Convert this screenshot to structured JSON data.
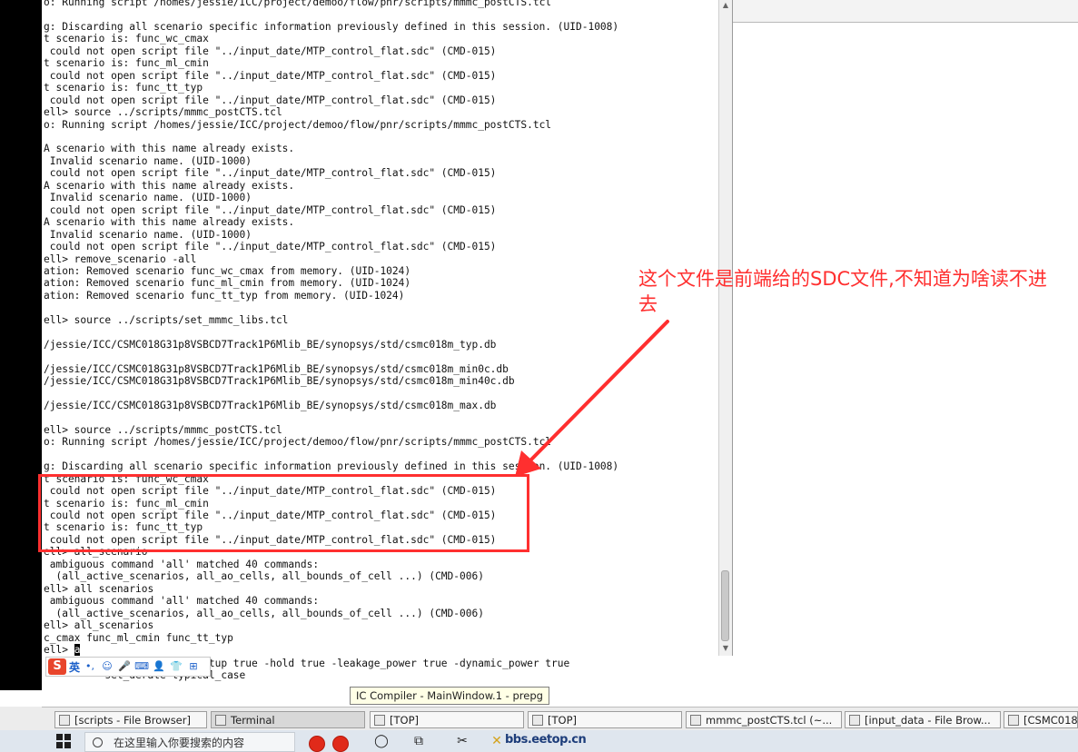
{
  "terminal": {
    "lines": [
      "o: Running script /homes/jessie/ICC/project/demoo/flow/pnr/scripts/mmmc_postCTS.tcl",
      "",
      "g: Discarding all scenario specific information previously defined in this session. (UID-1008)",
      "t scenario is: func_wc_cmax",
      " could not open script file \"../input_date/MTP_control_flat.sdc\" (CMD-015)",
      "t scenario is: func_ml_cmin",
      " could not open script file \"../input_date/MTP_control_flat.sdc\" (CMD-015)",
      "t scenario is: func_tt_typ",
      " could not open script file \"../input_date/MTP_control_flat.sdc\" (CMD-015)",
      "ell> source ../scripts/mmmc_postCTS.tcl",
      "o: Running script /homes/jessie/ICC/project/demoo/flow/pnr/scripts/mmmc_postCTS.tcl",
      "",
      "A scenario with this name already exists.",
      " Invalid scenario name. (UID-1000)",
      " could not open script file \"../input_date/MTP_control_flat.sdc\" (CMD-015)",
      "A scenario with this name already exists.",
      " Invalid scenario name. (UID-1000)",
      " could not open script file \"../input_date/MTP_control_flat.sdc\" (CMD-015)",
      "A scenario with this name already exists.",
      " Invalid scenario name. (UID-1000)",
      " could not open script file \"../input_date/MTP_control_flat.sdc\" (CMD-015)",
      "ell> remove_scenario -all",
      "ation: Removed scenario func_wc_cmax from memory. (UID-1024)",
      "ation: Removed scenario func_ml_cmin from memory. (UID-1024)",
      "ation: Removed scenario func_tt_typ from memory. (UID-1024)",
      "",
      "ell> source ../scripts/set_mmmc_libs.tcl",
      "",
      "/jessie/ICC/CSMC018G31p8VSBCD7Track1P6Mlib_BE/synopsys/std/csmc018m_typ.db",
      "",
      "/jessie/ICC/CSMC018G31p8VSBCD7Track1P6Mlib_BE/synopsys/std/csmc018m_min0c.db",
      "/jessie/ICC/CSMC018G31p8VSBCD7Track1P6Mlib_BE/synopsys/std/csmc018m_min40c.db",
      "",
      "/jessie/ICC/CSMC018G31p8VSBCD7Track1P6Mlib_BE/synopsys/std/csmc018m_max.db",
      "",
      "ell> source ../scripts/mmmc_postCTS.tcl",
      "o: Running script /homes/jessie/ICC/project/demoo/flow/pnr/scripts/mmmc_postCTS.tcl",
      "",
      "g: Discarding all scenario specific information previously defined in this session. (UID-1008)",
      "t scenario is: func_wc_cmax",
      " could not open script file \"../input_date/MTP_control_flat.sdc\" (CMD-015)",
      "t scenario is: func_ml_cmin",
      " could not open script file \"../input_date/MTP_control_flat.sdc\" (CMD-015)",
      "t scenario is: func_tt_typ",
      " could not open script file \"../input_date/MTP_control_flat.sdc\" (CMD-015)",
      "ell> all_scenario",
      " ambiguous command 'all' matched 40 commands:",
      "  (all_active_scenarios, all_ao_cells, all_bounds_of_cell ...) (CMD-006)",
      "ell> all scenarios",
      " ambiguous command 'all' matched 40 commands:",
      "  (all_active_scenarios, all_ao_cells, all_bounds_of_cell ...) (CMD-006)",
      "ell> all_scenarios",
      "c_cmax func_ml_cmin func_tt_typ"
    ],
    "prompt": "ell> ",
    "input": "a"
  },
  "below_lines": [
    "                    ons -setup true -hold true -leakage_power true -dynamic_power true",
    "          set_derate typical_case"
  ],
  "ime": {
    "logo": "S",
    "mode": "英",
    "icons": [
      "•,",
      "☺",
      "🎤",
      "⌨",
      "👤",
      "👕",
      "⊞"
    ]
  },
  "tooltip": "IC Compiler - MainWindow.1 - prepg",
  "taskbar": {
    "items": [
      {
        "label": "[scripts - File Browser]",
        "active": false
      },
      {
        "label": "Terminal",
        "active": true
      },
      {
        "label": "[TOP]",
        "active": false
      },
      {
        "label": "[TOP]",
        "active": false
      },
      {
        "label": "mmmc_postCTS.tcl (~...",
        "active": false
      },
      {
        "label": "[input_data - File Brow...",
        "active": false
      },
      {
        "label": "[CSMC018",
        "active": false
      }
    ]
  },
  "windows": {
    "search_placeholder": "在这里输入你要搜索的内容",
    "watermark": "bbs.eetop.cn"
  },
  "annotation": {
    "text": "这个文件是前端给的SDC文件,不知道为啥读不进去",
    "color": "#ff2f2f"
  }
}
